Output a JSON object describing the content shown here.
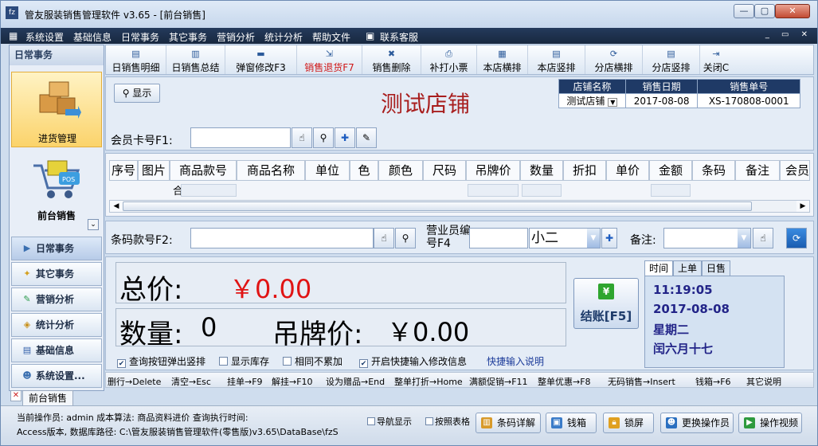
{
  "window": {
    "title": "管友服装销售管理软件 v3.65 - [前台销售]",
    "icon_text": "fz"
  },
  "menubar": {
    "items": [
      "系统设置",
      "基础信息",
      "日常事务",
      "其它事务",
      "营销分析",
      "统计分析",
      "帮助文件",
      "联系客服"
    ]
  },
  "sidebar": {
    "header": "日常事务",
    "purchase_label": "进货管理",
    "front_label": "前台销售",
    "categories": [
      "日常事务",
      "其它事务",
      "营销分析",
      "统计分析",
      "基础信息",
      "系统设置..."
    ]
  },
  "toolbar": {
    "items": [
      "日销售明细",
      "日销售总结",
      "弹窗修改F3",
      "销售退货F7",
      "销售删除",
      "补打小票",
      "本店横排",
      "本店竖排",
      "分店横排",
      "分店竖排",
      "关闭C"
    ]
  },
  "header": {
    "show_label": "显示",
    "store_title": "测试店铺",
    "info_headers": [
      "店铺名称",
      "销售日期",
      "销售单号"
    ],
    "store_name": "测试店铺",
    "sale_date": "2017-08-08",
    "order_no": "XS-170808-0001",
    "member_label": "会员卡号F1:"
  },
  "grid": {
    "columns": [
      "序号",
      "图片",
      "商品款号",
      "商品名称",
      "单位",
      "色",
      "颜色",
      "尺码",
      "吊牌价",
      "数量",
      "折扣",
      "单价",
      "金额",
      "条码",
      "备注",
      "会员"
    ],
    "summary_label": "合计:"
  },
  "entry": {
    "barcode_label": "条码款号F2:",
    "sales_label": "营业员编号F4",
    "sales_value": "小二",
    "remark_label": "备注:"
  },
  "totals": {
    "total_label": "总价:",
    "total_value": "￥0.00",
    "qty_label": "数量:",
    "qty_value": "0",
    "tag_label": "吊牌价:",
    "tag_value": "￥0.00",
    "options": [
      {
        "label": "查询按钮弹出竖排",
        "checked": true
      },
      {
        "label": "显示库存",
        "checked": false
      },
      {
        "label": "相同不累加",
        "checked": false
      },
      {
        "label": "开启快捷输入修改信息",
        "checked": true
      }
    ],
    "quick_help": "快捷输入说明",
    "checkout_label": "结账[F5]"
  },
  "clock": {
    "tabs": [
      "时间",
      "上单",
      "日售"
    ],
    "time": "11:19:05",
    "date": "2017-08-08",
    "weekday": "星期二",
    "lunar": "闰六月十七"
  },
  "shortcuts": [
    "删行→Delete",
    "清空→Esc",
    "挂单→F9",
    "解挂→F10",
    "设为赠品→End",
    "整单打折→Home",
    "满额促销→F11",
    "整单优惠→F8",
    "无码销售→Insert",
    "钱箱→F6",
    "其它说明"
  ],
  "doc_tab": "前台销售",
  "status": {
    "line1": "当前操作员: admin  成本算法: 商品资料进价  查询执行时间:",
    "line2": "Access版本, 数据库路径: C:\\管友服装销售管理软件(零售版)v3.65\\DataBase\\fzS",
    "nav_check": "导航显示",
    "table_check": "按照表格",
    "buttons": [
      "条码详解",
      "钱箱",
      "锁屏",
      "更换操作员",
      "操作视频"
    ]
  },
  "colors": {
    "accent": "#1f3a66",
    "total_red": "#e01414",
    "store_title": "#a81e1e",
    "menubar": "#1b2d47"
  }
}
